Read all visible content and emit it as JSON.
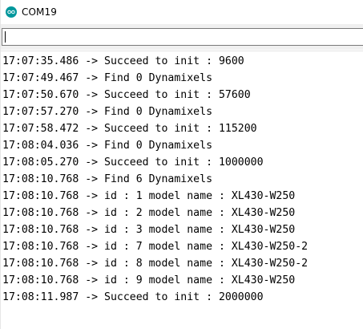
{
  "window": {
    "title": "COM19",
    "icon": "arduino-icon"
  },
  "send_input": {
    "value": ""
  },
  "serial_output": [
    "17:07:35.486 -> Succeed to init : 9600",
    "17:07:49.467 -> Find 0 Dynamixels",
    "17:07:50.670 -> Succeed to init : 57600",
    "17:07:57.270 -> Find 0 Dynamixels",
    "17:07:58.472 -> Succeed to init : 115200",
    "17:08:04.036 -> Find 0 Dynamixels",
    "17:08:05.270 -> Succeed to init : 1000000",
    "17:08:10.768 -> Find 6 Dynamixels",
    "17:08:10.768 -> id : 1 model name : XL430-W250",
    "17:08:10.768 -> id : 2 model name : XL430-W250",
    "17:08:10.768 -> id : 3 model name : XL430-W250",
    "17:08:10.768 -> id : 7 model name : XL430-W250-2",
    "17:08:10.768 -> id : 8 model name : XL430-W250-2",
    "17:08:10.768 -> id : 9 model name : XL430-W250",
    "17:08:11.987 -> Succeed to init : 2000000"
  ],
  "colors": {
    "accent": "#00979c"
  }
}
